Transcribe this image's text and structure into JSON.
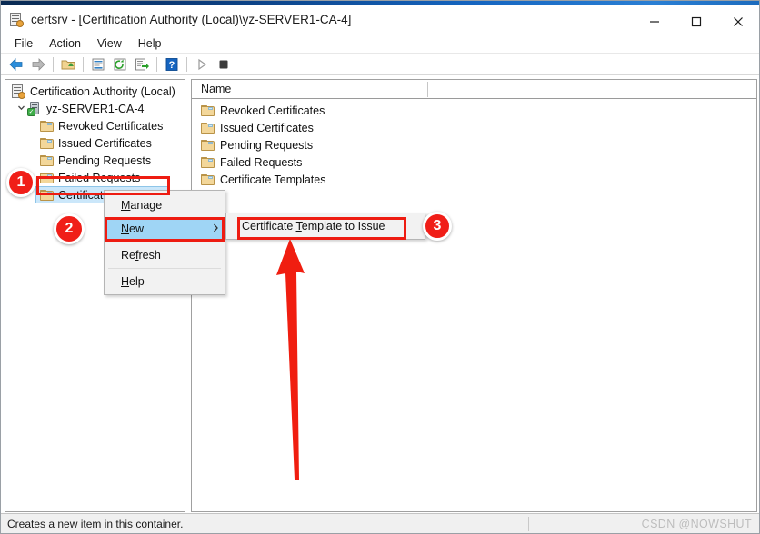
{
  "window": {
    "title": "certsrv - [Certification Authority (Local)\\yz-SERVER1-CA-4]",
    "icon": "certsrv-icon",
    "controls": {
      "minimize": "—",
      "maximize": "☐",
      "close": "✕"
    }
  },
  "menubar": {
    "items": [
      {
        "label": "File"
      },
      {
        "label": "Action"
      },
      {
        "label": "View"
      },
      {
        "label": "Help"
      }
    ]
  },
  "toolbar": {
    "buttons": [
      {
        "name": "back-arrow-icon",
        "glyph": "←"
      },
      {
        "name": "forward-arrow-icon",
        "glyph": "→"
      },
      {
        "name": "up-folder-icon",
        "glyph": "↰"
      },
      {
        "name": "properties-icon",
        "glyph": "▤"
      },
      {
        "name": "refresh-icon",
        "glyph": "↻"
      },
      {
        "name": "export-list-icon",
        "glyph": "➤"
      },
      {
        "name": "help-icon",
        "glyph": "?"
      },
      {
        "name": "start-service-icon",
        "glyph": "▶"
      },
      {
        "name": "stop-service-icon",
        "glyph": "■"
      }
    ]
  },
  "tree": {
    "root": {
      "label": "Certification Authority (Local)",
      "icon": "ca-root-icon"
    },
    "server": {
      "label": "yz-SERVER1-CA-4",
      "icon": "server-icon",
      "expanded": true,
      "chevron": "⌄"
    },
    "children": [
      {
        "label": "Revoked Certificates",
        "icon": "folder-icon",
        "selected": false
      },
      {
        "label": "Issued Certificates",
        "icon": "folder-icon",
        "selected": false
      },
      {
        "label": "Pending Requests",
        "icon": "folder-icon",
        "selected": false
      },
      {
        "label": "Failed Requests",
        "icon": "folder-icon",
        "selected": false
      },
      {
        "label": "Certificate Templates",
        "icon": "folder-icon",
        "selected": true
      }
    ]
  },
  "list": {
    "columns": [
      {
        "label": "Name"
      }
    ],
    "rows": [
      {
        "label": "Revoked Certificates",
        "icon": "folder-icon"
      },
      {
        "label": "Issued Certificates",
        "icon": "folder-icon"
      },
      {
        "label": "Pending Requests",
        "icon": "folder-icon"
      },
      {
        "label": "Failed Requests",
        "icon": "folder-icon"
      },
      {
        "label": "Certificate Templates",
        "icon": "folder-icon"
      }
    ]
  },
  "context_menu": {
    "items": [
      {
        "label": "Manage",
        "accel": "M",
        "highlighted": false,
        "has_submenu": false
      },
      {
        "label": "New",
        "accel": "N",
        "highlighted": true,
        "has_submenu": true,
        "submenu_arrow": "›"
      },
      {
        "label": "Refresh",
        "accel": "f",
        "highlighted": false,
        "has_submenu": false
      },
      {
        "label": "Help",
        "accel": "H",
        "highlighted": false,
        "has_submenu": false
      }
    ]
  },
  "submenu": {
    "items": [
      {
        "label": "Certificate Template to Issue",
        "accel": "T"
      }
    ]
  },
  "statusbar": {
    "text": "Creates a new item in this container.",
    "watermark": "CSDN @NOWSHUT"
  },
  "annotations": {
    "badges": [
      {
        "id": "1",
        "label": "1"
      },
      {
        "id": "2",
        "label": "2"
      },
      {
        "id": "3",
        "label": "3"
      }
    ],
    "arrow": {
      "name": "pointer-arrow",
      "direction": "up",
      "color": "#f01e10"
    },
    "highlight_color": "#ee1c12"
  },
  "colors": {
    "titlebar_accent": "#0b3d7d",
    "selection_blue": "#cbe7fa",
    "menu_highlight": "#9fd5f5",
    "annotation_red": "#f01e18",
    "folder_yellow": "#f3d79a"
  }
}
